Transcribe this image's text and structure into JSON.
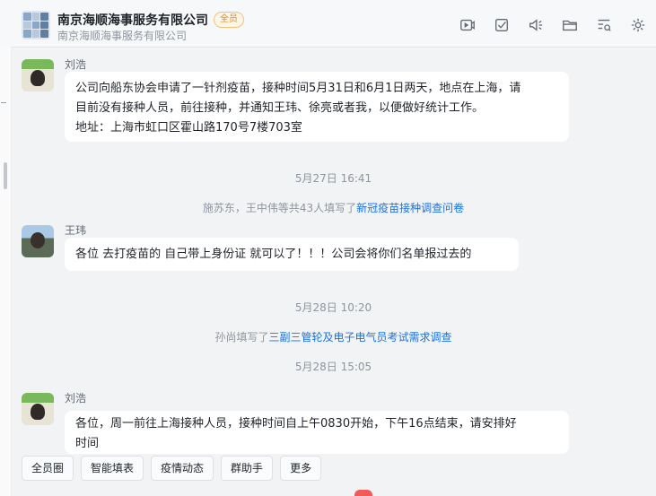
{
  "header": {
    "title": "南京海顺海事服务有限公司",
    "badge": "全员",
    "subtitle": "南京海顺海事服务有限公司",
    "tools": [
      "video-icon",
      "checklist-icon",
      "speaker-icon",
      "folder-icon",
      "search-list-icon",
      "settings-icon"
    ]
  },
  "messages": [
    {
      "sender": "刘浩",
      "lines": [
        "公司向船东协会申请了一针剂疫苗，接种时间5月31日和6月1日两天，地点在上海，请",
        "目前没有接种人员，前往接种，并通知王玮、徐亮或者我，以便做好统计工作。",
        "地址：上海市虹口区霍山路170号7楼703室"
      ]
    },
    {
      "sender": "王玮",
      "lines": [
        "各位  去打疫苗的  自己带上身份证 就可以了！！！公司会将你们名单报过去的"
      ]
    },
    {
      "sender": "刘浩",
      "lines": [
        "各位，周一前往上海接种人员，接种时间自上午0830开始，下午16点结束，请安排好",
        "时间"
      ]
    }
  ],
  "system": {
    "time1": "5月27日 16:41",
    "notice1_text": "施苏东，王中伟等共43人填写了",
    "notice1_link": "新冠疫苗接种调查问卷",
    "time2": "5月28日 10:20",
    "notice2_text": "孙尚填写了",
    "notice2_link": "三副三管轮及电子电气员考试需求调查",
    "time3": "5月28日 15:05"
  },
  "quickbar": [
    "全员圈",
    "智能填表",
    "疫情动态",
    "群助手",
    "更多"
  ]
}
